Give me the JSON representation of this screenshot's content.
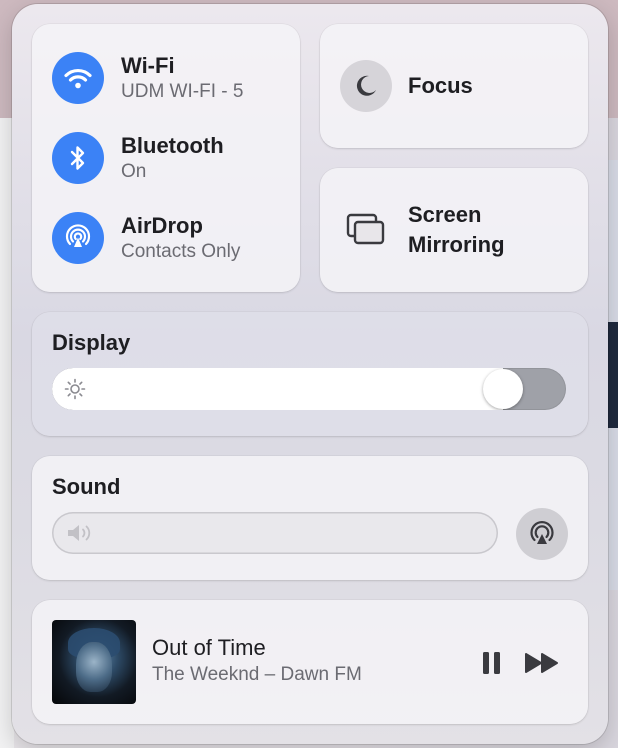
{
  "connectivity": {
    "wifi": {
      "title": "Wi-Fi",
      "status": "UDM WI-FI - 5"
    },
    "bluetooth": {
      "title": "Bluetooth",
      "status": "On"
    },
    "airdrop": {
      "title": "AirDrop",
      "status": "Contacts Only"
    }
  },
  "focus": {
    "label": "Focus"
  },
  "screen_mirroring": {
    "label": "Screen\nMirroring"
  },
  "display": {
    "title": "Display",
    "brightness": 0.91
  },
  "sound": {
    "title": "Sound",
    "volume": 0.0
  },
  "now_playing": {
    "title": "Out of Time",
    "subtitle": "The Weeknd – Dawn FM"
  },
  "colors": {
    "accent": "#3b82f6",
    "text_primary": "#1e1e22",
    "text_secondary": "#6b6b72"
  },
  "icons": [
    "wifi-icon",
    "bluetooth-icon",
    "airdrop-icon",
    "moon-icon",
    "screen-mirroring-icon",
    "sun-icon",
    "speaker-icon",
    "airplay-audio-icon",
    "pause-icon",
    "fast-forward-icon"
  ]
}
